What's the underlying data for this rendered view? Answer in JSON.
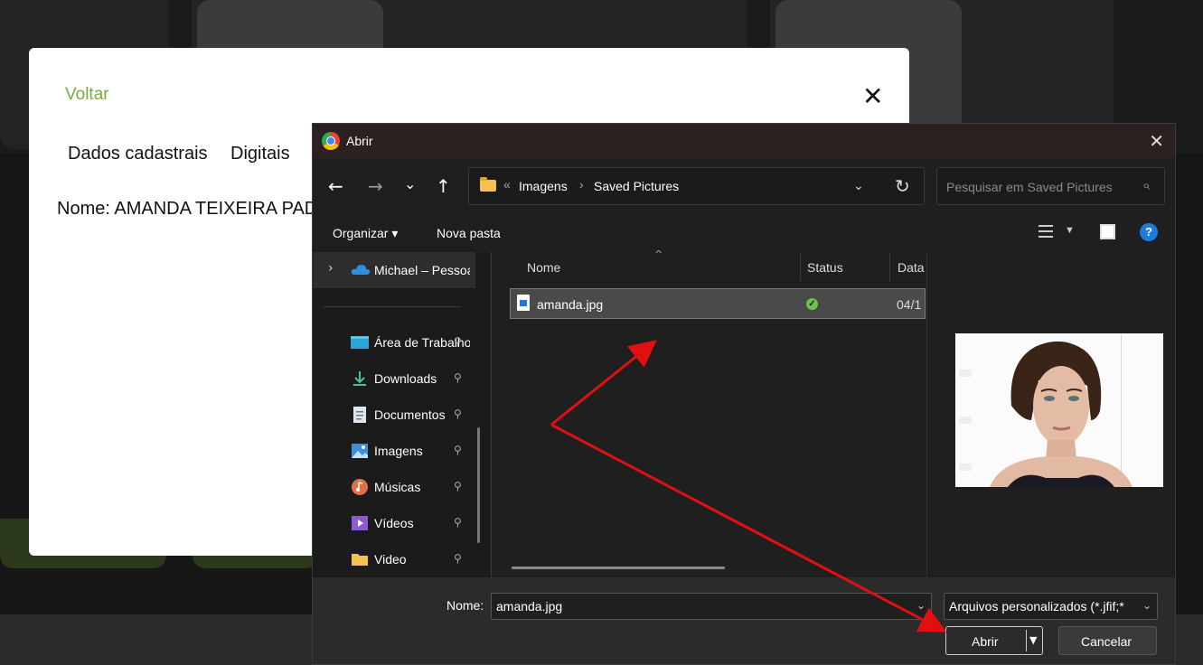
{
  "background_page": {
    "modal": {
      "back_link": "Voltar",
      "close_symbol": "✕",
      "tabs": [
        "Dados cadastrais",
        "Digitais"
      ],
      "name_line": "Nome: AMANDA TEIXEIRA PAD"
    }
  },
  "file_dialog": {
    "title": "Abrir",
    "close_symbol": "✕",
    "nav": {
      "back": "←",
      "forward": "→",
      "recent": "⌄",
      "up": "↑",
      "breadcrumb_overflow": "«",
      "breadcrumbs": [
        "Imagens",
        "Saved Pictures"
      ],
      "breadcrumb_separator": "›",
      "dropdown": "⌄",
      "refresh": "↻"
    },
    "search": {
      "placeholder": "Pesquisar em Saved Pictures",
      "icon": "search-icon"
    },
    "commands": {
      "organize": "Organizar ▾",
      "new_folder": "Nova pasta",
      "help": "?"
    },
    "sidebar": {
      "onedrive": "Michael – Pessoal",
      "items": [
        {
          "label": "Área de Trabalho",
          "icon": "desktop-icon"
        },
        {
          "label": "Downloads",
          "icon": "download-icon"
        },
        {
          "label": "Documentos",
          "icon": "document-icon"
        },
        {
          "label": "Imagens",
          "icon": "pictures-icon"
        },
        {
          "label": "Músicas",
          "icon": "music-icon"
        },
        {
          "label": "Vídeos",
          "icon": "video-icon"
        },
        {
          "label": "Video",
          "icon": "folder-icon"
        }
      ],
      "pin_symbol": "📌"
    },
    "columns": [
      "Nome",
      "Status",
      "Data"
    ],
    "files": [
      {
        "name": "amanda.jpg",
        "status": "✓",
        "date": "04/1",
        "selected": true
      }
    ],
    "footer": {
      "name_label": "Nome:",
      "name_value": "amanda.jpg",
      "filter_value": "Arquivos personalizados (*.jfif;*",
      "open_label": "Abrir",
      "cancel_label": "Cancelar"
    }
  },
  "colors": {
    "accent_green": "#7aab3a",
    "annotation_red": "#e01010",
    "dialog_bg": "#202020",
    "selection": "#4a4a4a"
  }
}
